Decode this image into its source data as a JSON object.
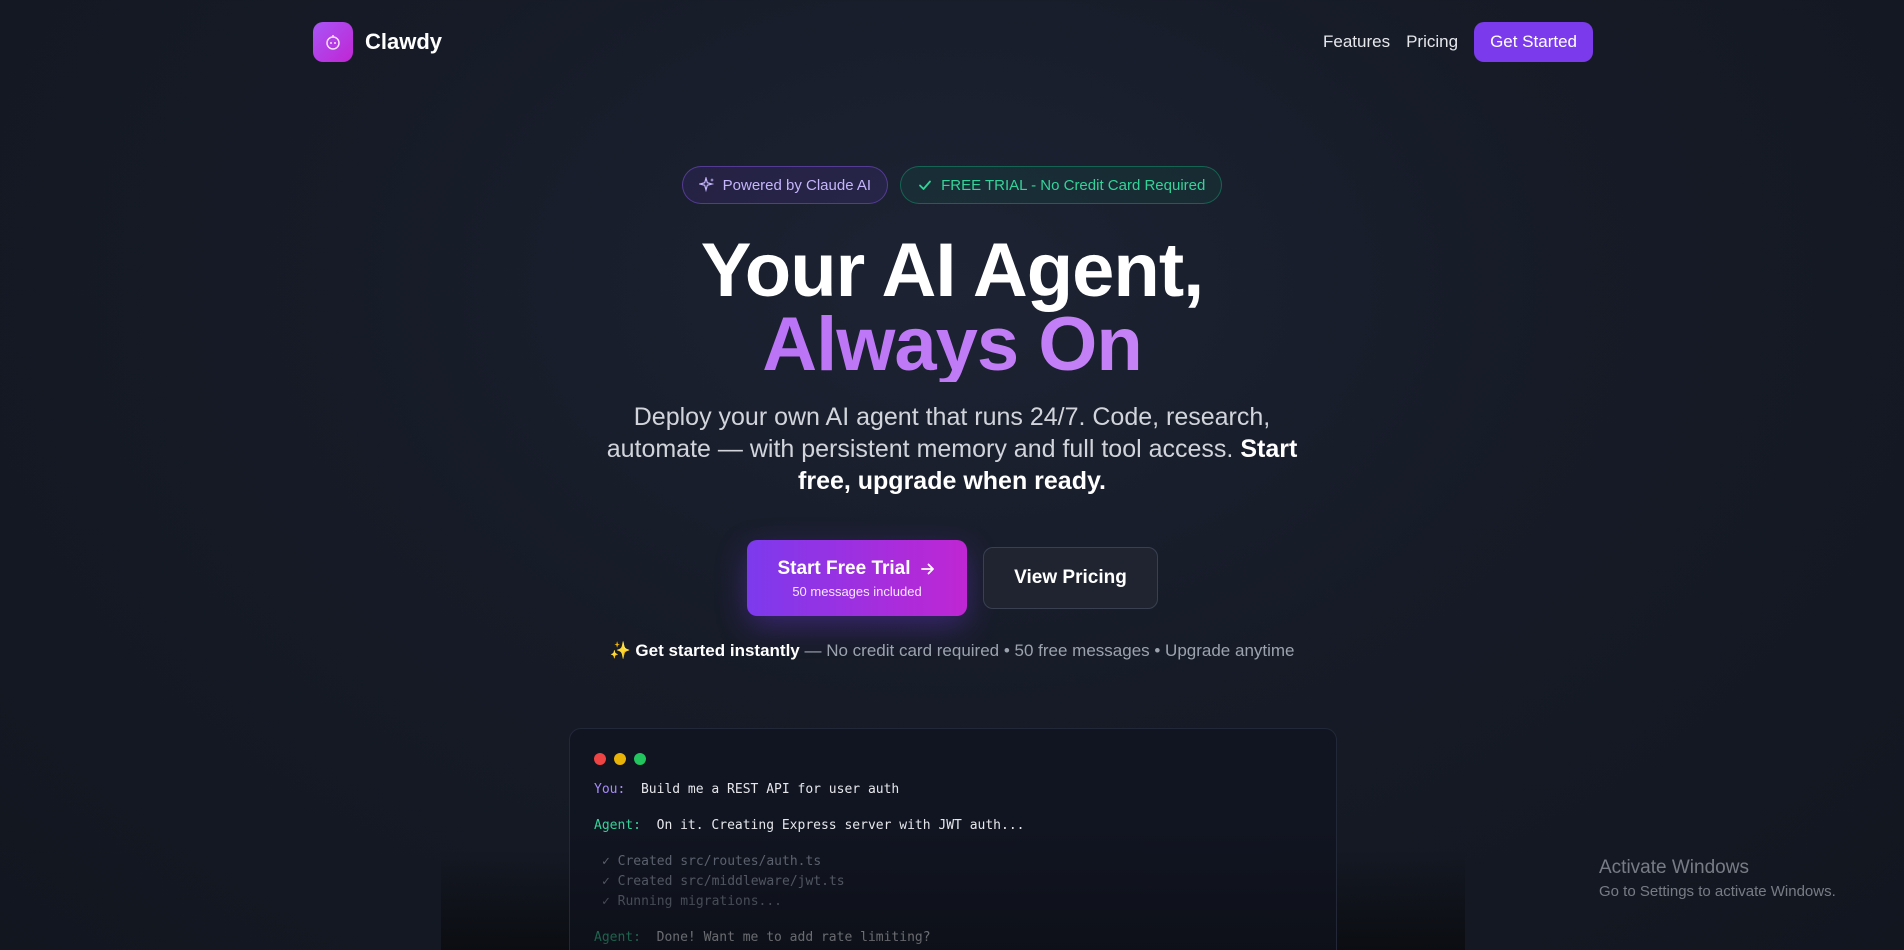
{
  "nav": {
    "brand": "Clawdy",
    "links": [
      "Features",
      "Pricing"
    ],
    "cta": "Get Started"
  },
  "badges": {
    "powered": "Powered by Claude AI",
    "trial": "FREE TRIAL - No Credit Card Required"
  },
  "hero": {
    "title_line1": "Your AI Agent,",
    "title_line2": "Always On",
    "subtitle_part1": "Deploy your own AI agent that runs 24/7. Code, research, automate — with persistent memory and full tool access. ",
    "subtitle_strong": "Start free, upgrade when ready."
  },
  "cta": {
    "primary_label": "Start Free Trial",
    "primary_sub": "50 messages included",
    "secondary_label": "View Pricing"
  },
  "note": {
    "icon": "✨",
    "strong": "Get started instantly",
    "rest": " — No credit card required • 50 free messages • Upgrade anytime"
  },
  "terminal": {
    "dot_colors": [
      "#ef4444",
      "#eab308",
      "#22c55e"
    ],
    "you_label": "You:",
    "you_msg": "Build me a REST API for user auth",
    "agent_label": "Agent:",
    "agent_msg": "On it. Creating Express server with JWT auth...",
    "logs": [
      "✓ Created src/routes/auth.ts",
      "✓ Created src/middleware/jwt.ts",
      "✓ Running migrations..."
    ],
    "agent_label2": "Agent:",
    "agent_msg2": "Done! Want me to add rate limiting?"
  },
  "watermark": {
    "title": "Activate Windows",
    "sub": "Go to Settings to activate Windows."
  },
  "colors": {
    "accent": "#7c3aed",
    "accent2": "#c026d3",
    "success": "#34d399"
  }
}
